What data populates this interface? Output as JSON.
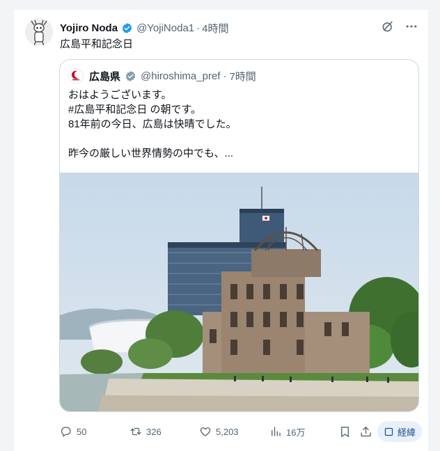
{
  "tweet": {
    "display_name": "Yojiro Noda",
    "handle": "@YojiNoda1",
    "separator": "·",
    "time": "4時間",
    "text": "広島平和記念日"
  },
  "quote": {
    "display_name": "広島県",
    "handle": "@hiroshima_pref",
    "separator": "·",
    "time": "7時間",
    "lines": [
      "おはようございます。",
      "#広島平和記念日 の朝です。",
      "81年前の今日、広島は快晴でした。",
      "",
      "昨今の厳しい世界情勢の中でも、..."
    ],
    "image_icon": "atomic-bomb-dome-photo"
  },
  "actions": {
    "replies": "50",
    "reposts": "326",
    "likes": "5,203",
    "views": "16万",
    "translate_label": "経緯"
  },
  "icons": {
    "verified": "verified-badge-icon",
    "grok": "grok-icon",
    "more": "more-dots-icon",
    "reply": "reply-icon",
    "repost": "repost-icon",
    "like": "heart-icon",
    "views": "views-chart-icon",
    "bookmark": "bookmark-icon",
    "share": "share-icon"
  },
  "colors": {
    "text": "#0f1419",
    "muted": "#536471",
    "verified": "#1d9bf0",
    "border": "#cfd9de",
    "translate_bg": "#e8f0fb"
  }
}
